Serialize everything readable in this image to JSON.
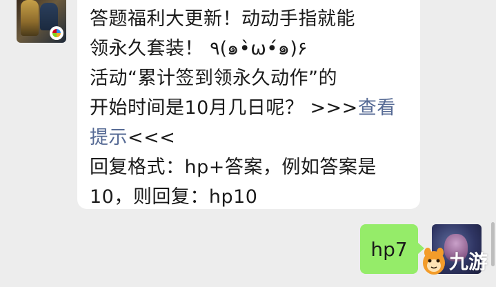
{
  "incoming_message": {
    "lines": [
      {
        "text": "答题福利大更新！动动手指就能"
      },
      {
        "text": "领永久套装！ ٩(๑•̀ω•́๑)۶"
      },
      {
        "text": "活动“累计签到领永久动作”的"
      },
      {
        "text": "开始时间是10月几日呢？ >>>",
        "link": "查看"
      },
      {
        "link": "提示",
        "text": "<<<"
      },
      {
        "text": "回复格式：hp+答案，例如答案是"
      },
      {
        "text": "10，则回复：hp10"
      }
    ]
  },
  "outgoing_message": {
    "text": "hp7"
  },
  "watermark": {
    "text": "九游"
  },
  "colors": {
    "background": "#ededed",
    "incoming_bubble": "#ffffff",
    "outgoing_bubble": "#95ec69",
    "link": "#576b95"
  }
}
